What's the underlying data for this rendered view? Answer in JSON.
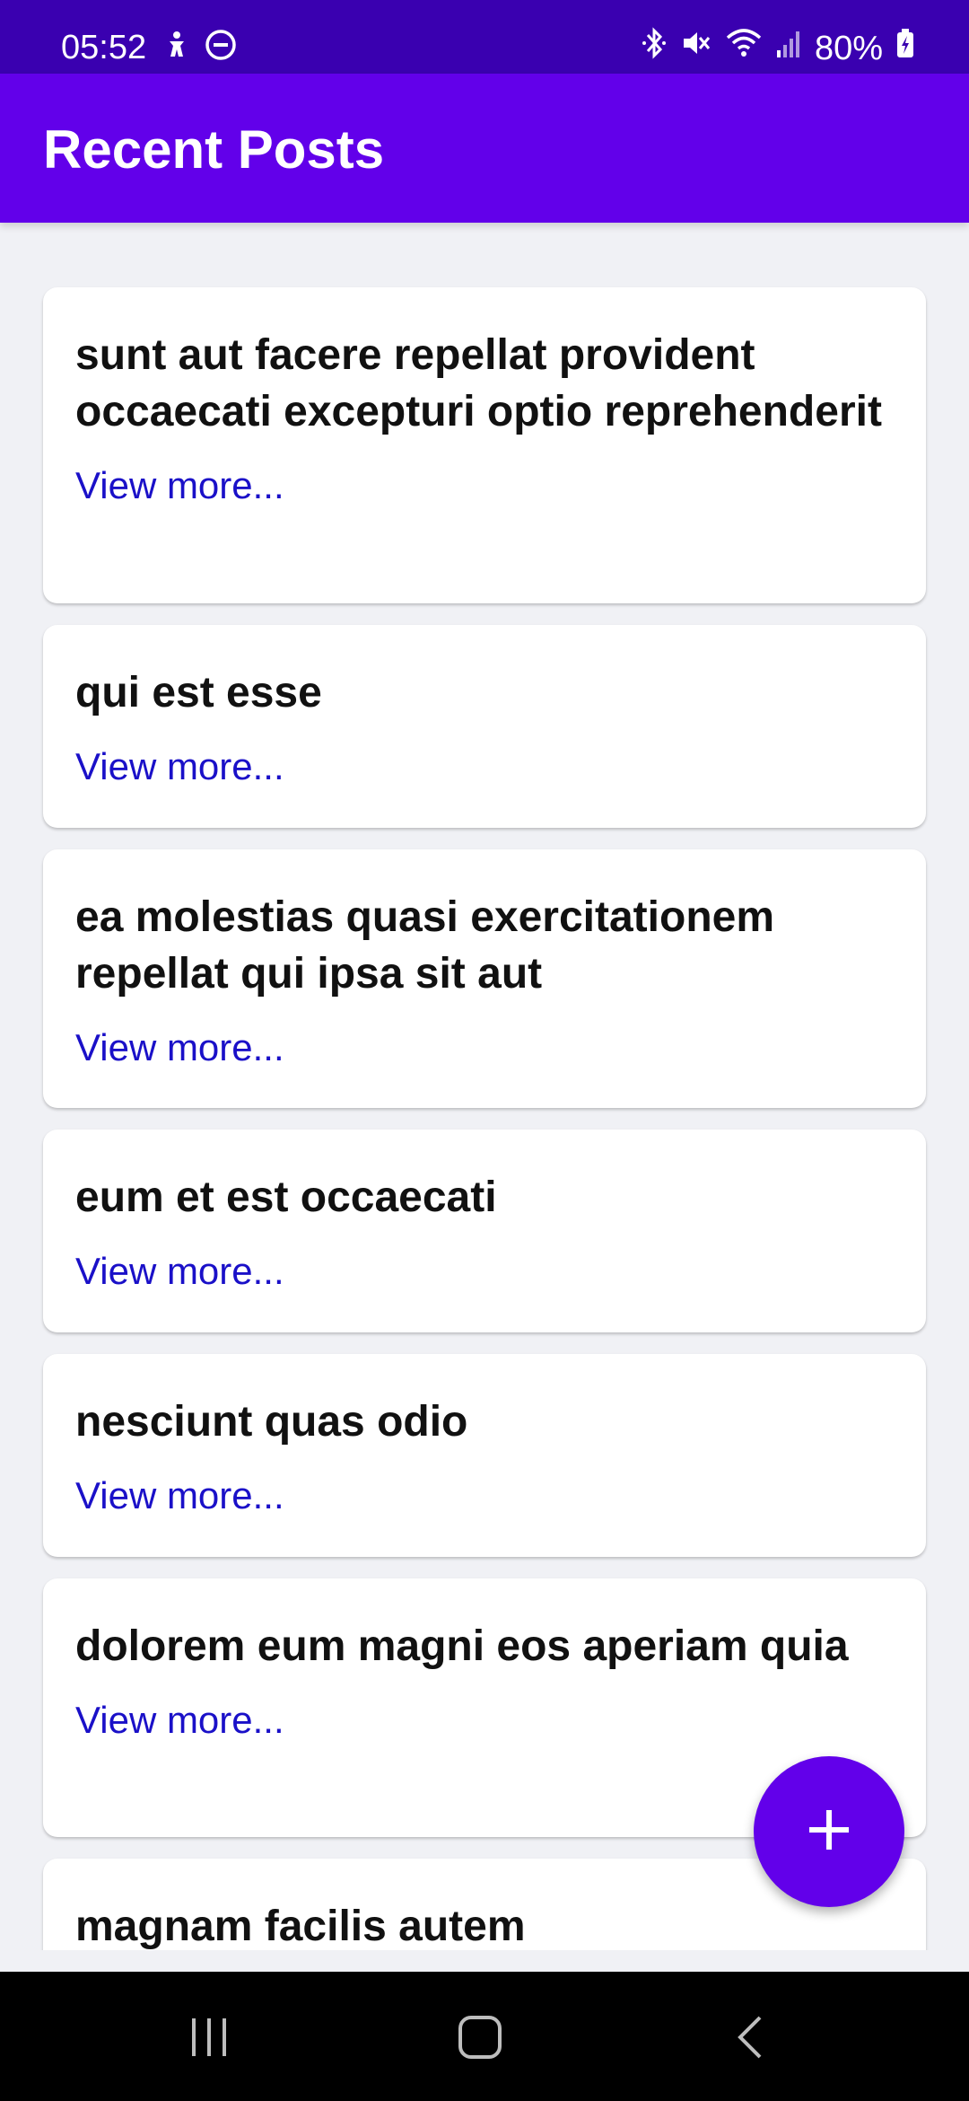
{
  "status_bar": {
    "time": "05:52",
    "battery": "80%",
    "left_icons": [
      "accessibility-icon",
      "do-not-disturb-icon"
    ],
    "right_icons": [
      "bluetooth-icon",
      "mute-icon",
      "wifi-icon",
      "signal-icon",
      "battery-charging-icon"
    ]
  },
  "app_bar": {
    "title": "Recent Posts"
  },
  "posts": [
    {
      "title": "sunt aut facere repellat provident occaecati excepturi optio reprehenderit",
      "link": "View more..."
    },
    {
      "title": "qui est esse",
      "link": "View more..."
    },
    {
      "title": "ea molestias quasi exercitationem repellat qui ipsa sit aut",
      "link": "View more..."
    },
    {
      "title": "eum et est occaecati",
      "link": "View more..."
    },
    {
      "title": "nesciunt quas odio",
      "link": "View more..."
    },
    {
      "title": "dolorem eum magni eos aperiam quia",
      "link": "View more..."
    },
    {
      "title": "magnam facilis autem",
      "link": ""
    }
  ],
  "fab": {
    "icon": "plus-icon"
  },
  "nav_bar": {
    "icons": [
      "recent-apps-icon",
      "home-icon",
      "back-icon"
    ]
  },
  "colors": {
    "primary": "#6200ea",
    "status_bar": "#3a00b0",
    "link": "#1a10c8",
    "background": "#f0f1f5"
  }
}
